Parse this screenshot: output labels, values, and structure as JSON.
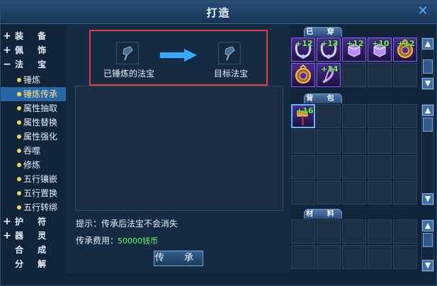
{
  "window": {
    "title": "打造"
  },
  "nav": {
    "items": [
      {
        "kind": "cat",
        "sign": "+",
        "label": "装 备",
        "active": false
      },
      {
        "kind": "cat",
        "sign": "+",
        "label": "佩 饰",
        "active": false
      },
      {
        "kind": "cat",
        "sign": "−",
        "label": "法 宝",
        "active": false
      },
      {
        "kind": "sub",
        "label": "锤炼",
        "active": false
      },
      {
        "kind": "sub",
        "label": "锤炼传承",
        "active": true
      },
      {
        "kind": "sub",
        "label": "属性抽取",
        "active": false
      },
      {
        "kind": "sub",
        "label": "属性替换",
        "active": false
      },
      {
        "kind": "sub",
        "label": "属性强化",
        "active": false
      },
      {
        "kind": "sub",
        "label": "吞噬",
        "active": false
      },
      {
        "kind": "sub",
        "label": "修炼",
        "active": false
      },
      {
        "kind": "sub",
        "label": "五行镶嵌",
        "active": false
      },
      {
        "kind": "sub",
        "label": "五行置换",
        "active": false
      },
      {
        "kind": "sub",
        "label": "五行转绑",
        "active": false
      },
      {
        "kind": "cat",
        "sign": "+",
        "label": "护 符",
        "active": false
      },
      {
        "kind": "cat",
        "sign": "+",
        "label": "器 灵",
        "active": false
      },
      {
        "kind": "cat",
        "sign": "",
        "label": "合 成",
        "active": false
      },
      {
        "kind": "cat",
        "sign": "",
        "label": "分 解",
        "active": false
      }
    ]
  },
  "center": {
    "source_slot_label": "已锤炼的法宝",
    "target_slot_label": "目标法宝",
    "hint": "提示：传承后法宝不会消失",
    "cost_label": "传承费用：",
    "cost_value": "50000钱币",
    "action_button": "传 承"
  },
  "right": {
    "equipped": {
      "title": "已 穿",
      "items": [
        {
          "level": "+12",
          "icon": "chain-necklace-icon"
        },
        {
          "level": "+13",
          "icon": "chain-necklace-icon"
        },
        {
          "level": "+12",
          "icon": "crystal-box-icon"
        },
        {
          "level": "+10",
          "icon": "crystal-box-icon"
        },
        {
          "level": "+12",
          "icon": "amulet-icon"
        },
        {
          "level": "",
          "icon": "amulet-icon"
        },
        {
          "level": "+14",
          "icon": "bow-icon"
        }
      ]
    },
    "bag": {
      "title": "背 包",
      "items": [
        {
          "level": "+16",
          "icon": "hammer-icon",
          "selected": true
        }
      ]
    },
    "materials": {
      "title": "材 料",
      "items": []
    }
  }
}
